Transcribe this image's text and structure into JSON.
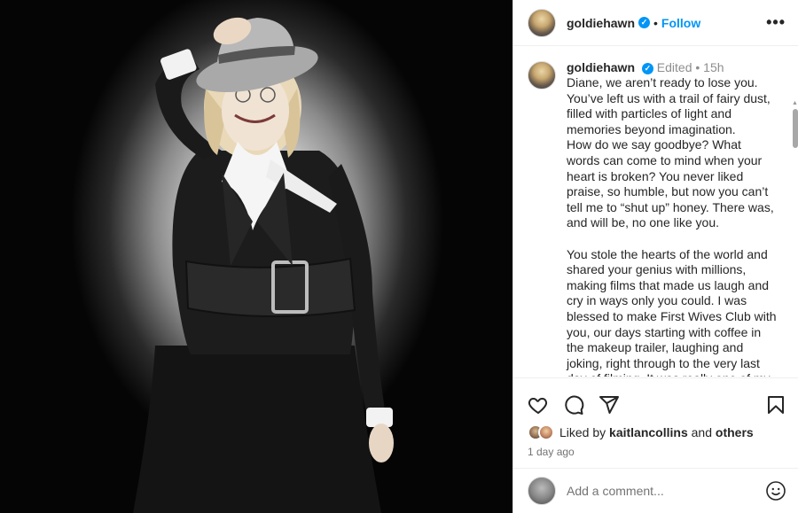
{
  "post": {
    "username": "goldiehawn",
    "follow_label": "Follow",
    "more_label": "•••",
    "caption_meta": {
      "edited": "Edited",
      "time": "15h"
    },
    "caption_text": "Diane, we aren’t ready to lose you. You’ve left us with a trail of fairy dust, filled with particles of light and memories beyond imagination.\nHow do we say goodbye? What words can come to mind when your heart is broken? You never liked praise, so humble, but now you can’t tell me to “shut up” honey. There was, and will be, no one like you.\n\nYou stole the hearts of the world and shared your genius with millions, making films that made us laugh and cry in ways only you could. I was blessed to make First Wives Club with you, our days starting with coffee in the makeup trailer, laughing and joking, right through to the very last day of filming. It was really one of my",
    "likes": {
      "prefix": "Liked by",
      "user": "kaitlancollins",
      "and": "and",
      "others": "others"
    },
    "timeago": "1 day ago"
  },
  "comment": {
    "placeholder": "Add a comment..."
  },
  "icons": {
    "like": "heart-icon",
    "comment": "comment-icon",
    "share": "share-icon",
    "save": "bookmark-icon",
    "emoji": "emoji-icon",
    "verified": "verified-badge-icon"
  },
  "colors": {
    "accent": "#0095f6",
    "muted": "#8e8e8e",
    "text": "#262626"
  }
}
